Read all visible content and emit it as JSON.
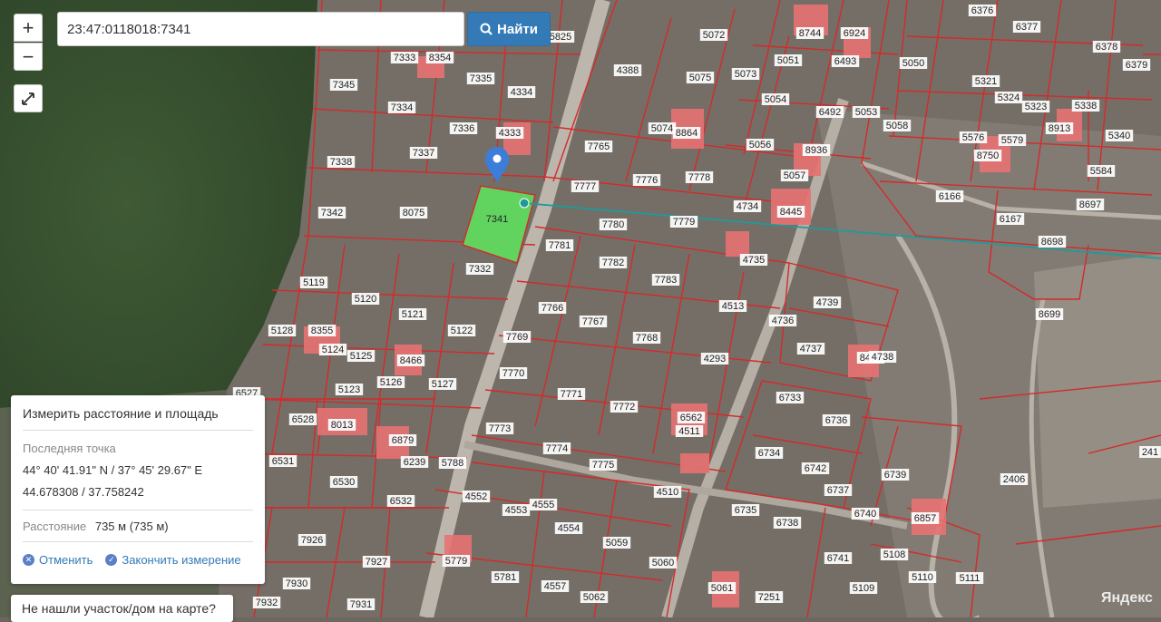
{
  "search": {
    "value": "23:47:0118018:7341",
    "button_label": "Найти"
  },
  "zoom": {
    "in_label": "+",
    "out_label": "−"
  },
  "measure": {
    "title": "Измерить расстояние и площадь",
    "last_point_label": "Последняя точка",
    "coords_dms": "44° 40' 41.91\" N / 37° 45' 29.67\" E",
    "coords_decimal": "44.678308 / 37.758242",
    "distance_label": "Расстояние",
    "distance_value": "735 м (735 м)",
    "cancel_label": "Отменить",
    "finish_label": "Закончить измерение"
  },
  "not_found": "Не нашли участок/дом на карте?",
  "attribution": {
    "logo": "Яндекс"
  },
  "selected_plot": "7341",
  "colors": {
    "parcel_line": "#d42a2a",
    "selected_fill": "#5fe05f",
    "measure_line": "#1d9b9b",
    "marker": "#3b7dd8"
  },
  "plots": [
    "5825",
    "5072",
    "8744",
    "6924",
    "6376",
    "6377",
    "6378",
    "6379",
    "7333",
    "8354",
    "7345",
    "7335",
    "4334",
    "4388",
    "5075",
    "5073",
    "5051",
    "6493",
    "5050",
    "5321",
    "5324",
    "5323",
    "7334",
    "7336",
    "4333",
    "7765",
    "5074",
    "8864",
    "5054",
    "6492",
    "5053",
    "5058",
    "5576",
    "5579",
    "8750",
    "8913",
    "5338",
    "5340",
    "7337",
    "7338",
    "7777",
    "7776",
    "7778",
    "5056",
    "8936",
    "5057",
    "5584",
    "7341",
    "8075",
    "4734",
    "8445",
    "6166",
    "6167",
    "8697",
    "7342",
    "7780",
    "7779",
    "7781",
    "7782",
    "7783",
    "4735",
    "8698",
    "7332",
    "5119",
    "5120",
    "5121",
    "7766",
    "4513",
    "4739",
    "8699",
    "5128",
    "8355",
    "5124",
    "5125",
    "5122",
    "7767",
    "7768",
    "4736",
    "5123",
    "8466",
    "5126",
    "5127",
    "7769",
    "7770",
    "4293",
    "4737",
    "8476",
    "4738",
    "6527",
    "6528",
    "8013",
    "6879",
    "7771",
    "7772",
    "6562",
    "4511",
    "6733",
    "6736",
    "6531",
    "6239",
    "7773",
    "7774",
    "7775",
    "6734",
    "6742",
    "6739",
    "6530",
    "5788",
    "4552",
    "4553",
    "4555",
    "4510",
    "6735",
    "6737",
    "2406",
    "6532",
    "4554",
    "6740",
    "6738",
    "6857",
    "7926",
    "7927",
    "5779",
    "5781",
    "5059",
    "5060",
    "5108",
    "6741",
    "5110",
    "5111",
    "7930",
    "5061",
    "7251",
    "5109",
    "7931",
    "7932",
    "4557",
    "5062",
    "241"
  ]
}
